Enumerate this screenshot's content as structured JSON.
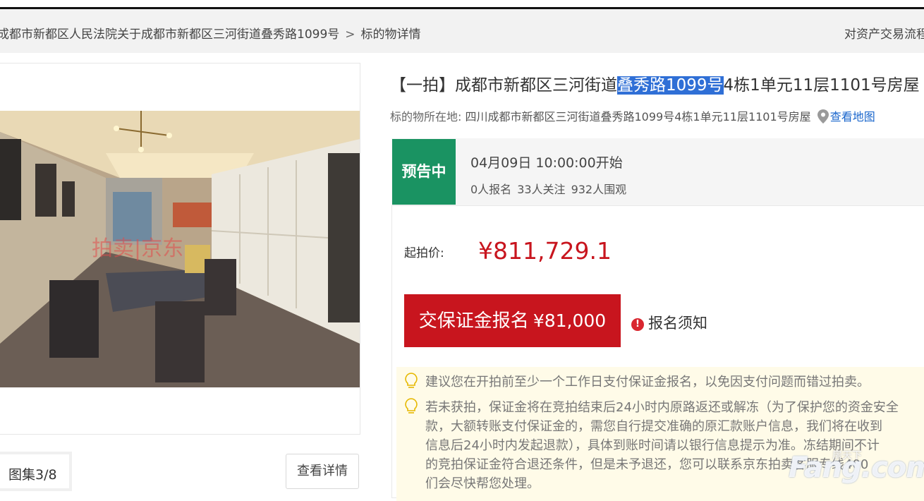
{
  "breadcrumb": {
    "item1": "成都市新都区人民法院关于成都市新都区三河街道叠秀路1099号",
    "separator": ">",
    "item2": "标的物详情"
  },
  "header_right_link": "对资产交易流程",
  "gallery": {
    "album_label": "图集3/8",
    "view_details": "查看详情",
    "photo_watermark": "拍卖|京东"
  },
  "listing": {
    "title_prefix": "【一拍】成都市新都区三河街道",
    "title_highlight": "叠秀路1099号",
    "title_suffix": "4栋1单元11层1101号房屋",
    "location_label": "标的物所在地:",
    "location_address": "四川成都市新都区三河街道叠秀路1099号4栋1单元11层1101号房屋",
    "map_link": "查看地图"
  },
  "status": {
    "badge": "预告中",
    "start_time": "04月09日 10:00:00开始",
    "signups": "0人报名",
    "followers": "33人关注",
    "viewers": "932人围观",
    "badge_color": "#1a9362"
  },
  "pricing": {
    "start_label": "起拍价:",
    "start_price": "¥811,729.1",
    "deposit_button": "交保证金报名",
    "deposit_amount": "¥81,000",
    "notice_link": "报名须知",
    "accent_color": "#c8151e"
  },
  "tips": {
    "tip1": "建议您在开拍前至少一个工作日支付保证金报名，以免因支付问题而错过拍卖。",
    "tip2_l1": "若未获拍，保证金将在竞拍结束后24小时内原路返还或解冻（为了保护您的资金安全",
    "tip2_l2": "款，大额转账支付保证金的，需您自行提交准确的原汇款账户信息，我们将在收到",
    "tip2_l3": "信息后24小时内发起退款），具体到账时间请以银行信息提示为准。冻结期间不计",
    "tip2_l4": "的竞拍保证金符合退还条件，但是未予退还，您可以联系京东拍卖客服专线400",
    "tip2_l5": "们会尽快帮您处理。"
  },
  "watermark": {
    "brand": "Fang.com",
    "cn": "房天下"
  }
}
